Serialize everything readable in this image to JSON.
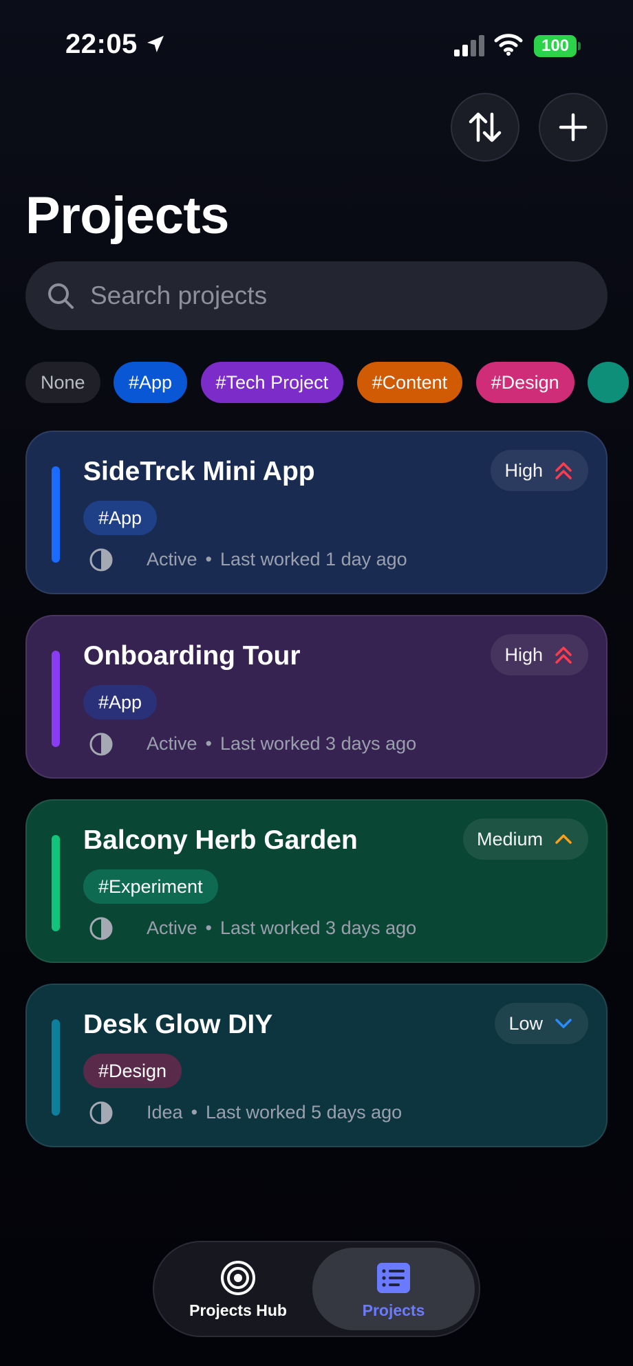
{
  "status_bar": {
    "time": "22:05",
    "battery": "100"
  },
  "header": {
    "title": "Projects",
    "sort_icon": "sort-arrows-icon",
    "add_icon": "plus-icon"
  },
  "search": {
    "placeholder": "Search projects",
    "value": ""
  },
  "filters": [
    {
      "label": "None",
      "color": "#1f2028",
      "text_color": "#b9bcc6"
    },
    {
      "label": "#App",
      "color": "#0a57d6"
    },
    {
      "label": "#Tech Project",
      "color": "#7b2cc9"
    },
    {
      "label": "#Content",
      "color": "#d15a05"
    },
    {
      "label": "#Design",
      "color": "#cf2d78"
    },
    {
      "label": "",
      "color": "#0d8f7a"
    }
  ],
  "projects": [
    {
      "title": "SideTrck Mini App",
      "tag": "#App",
      "status": "Active",
      "last_worked": "Last worked 1 day ago",
      "priority": "High",
      "priority_icon": "double-chevron-up-icon",
      "priority_color": "#ff3b4e",
      "accent_color": "#1a6bff",
      "card_color": "#1a2b52",
      "tag_color": "#1f3f86"
    },
    {
      "title": "Onboarding Tour",
      "tag": "#App",
      "status": "Active",
      "last_worked": "Last worked 3 days ago",
      "priority": "High",
      "priority_icon": "double-chevron-up-icon",
      "priority_color": "#ff3b4e",
      "accent_color": "#8a3df0",
      "card_color": "#372351",
      "tag_color": "#2a3178"
    },
    {
      "title": "Balcony Herb Garden",
      "tag": "#Experiment",
      "status": "Active",
      "last_worked": "Last worked 3 days ago",
      "priority": "Medium",
      "priority_icon": "chevron-up-icon",
      "priority_color": "#ff9f1a",
      "accent_color": "#12c47a",
      "card_color": "#0a4634",
      "tag_color": "#0e6b52"
    },
    {
      "title": "Desk Glow DIY",
      "tag": "#Design",
      "status": "Idea",
      "last_worked": "Last worked 5 days ago",
      "priority": "Low",
      "priority_icon": "chevron-down-icon",
      "priority_color": "#2b8cff",
      "accent_color": "#0f7f9e",
      "card_color": "#0c353f",
      "tag_color": "#5a2a4a"
    }
  ],
  "tabbar": {
    "hub_label": "Projects Hub",
    "projects_label": "Projects",
    "active_color": "#6b7bff"
  }
}
